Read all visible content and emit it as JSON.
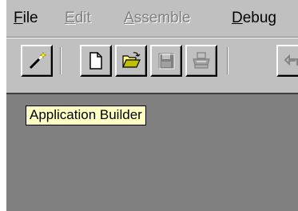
{
  "menu": [
    {
      "label": "File",
      "enabled": true
    },
    {
      "label": "Edit",
      "enabled": false
    },
    {
      "label": "Assemble",
      "enabled": false
    },
    {
      "label": "Debug",
      "enabled": true
    }
  ],
  "toolbar": {
    "buttons": [
      {
        "id": "application-builder",
        "icon": "magic-wand-icon",
        "enabled": true
      },
      {
        "id": "new",
        "icon": "new-document-icon",
        "enabled": true
      },
      {
        "id": "open",
        "icon": "open-folder-icon",
        "enabled": true
      },
      {
        "id": "save",
        "icon": "save-disk-icon",
        "enabled": false
      },
      {
        "id": "print",
        "icon": "printer-icon",
        "enabled": false
      },
      {
        "id": "undo",
        "icon": "undo-arrow-icon",
        "enabled": false
      }
    ]
  },
  "tooltip": {
    "text": "Application Builder"
  },
  "colors": {
    "face": "#c0c0c0",
    "workspace": "#808080",
    "tooltip_bg": "#ffffc4"
  }
}
